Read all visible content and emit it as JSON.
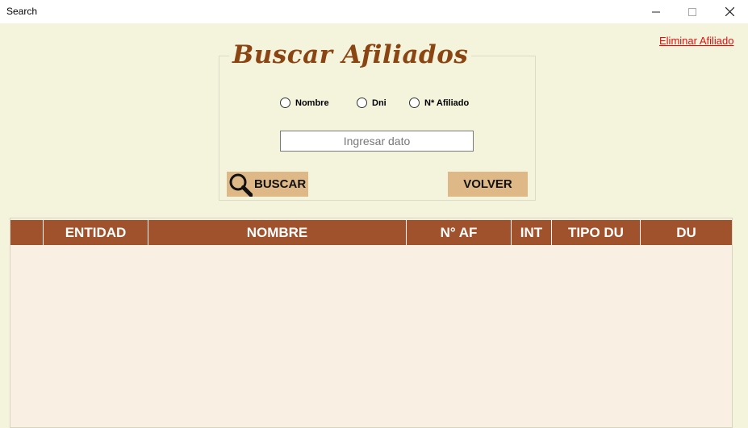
{
  "window": {
    "title": "Search"
  },
  "actions": {
    "delete_link": "Eliminar Afiliado"
  },
  "search_panel": {
    "title": "Buscar Afiliados",
    "radios": [
      {
        "label": "Nombre",
        "checked": false
      },
      {
        "label": "Dni",
        "checked": false
      },
      {
        "label": "N* Afiliado",
        "checked": false
      }
    ],
    "input": {
      "value": "",
      "placeholder": "Ingresar dato"
    },
    "search_button": "BUSCAR",
    "back_button": "VOLVER"
  },
  "table": {
    "columns": [
      "",
      "ENTIDAD",
      "NOMBRE",
      "N° AF",
      "INT",
      "TIPO DU",
      "DU"
    ],
    "rows": []
  },
  "colors": {
    "background": "#f4f3dc",
    "header": "#a0522d",
    "button": "#dfb887",
    "title": "#8b4513",
    "link": "#e01010",
    "grid_body": "#f9efe3"
  }
}
